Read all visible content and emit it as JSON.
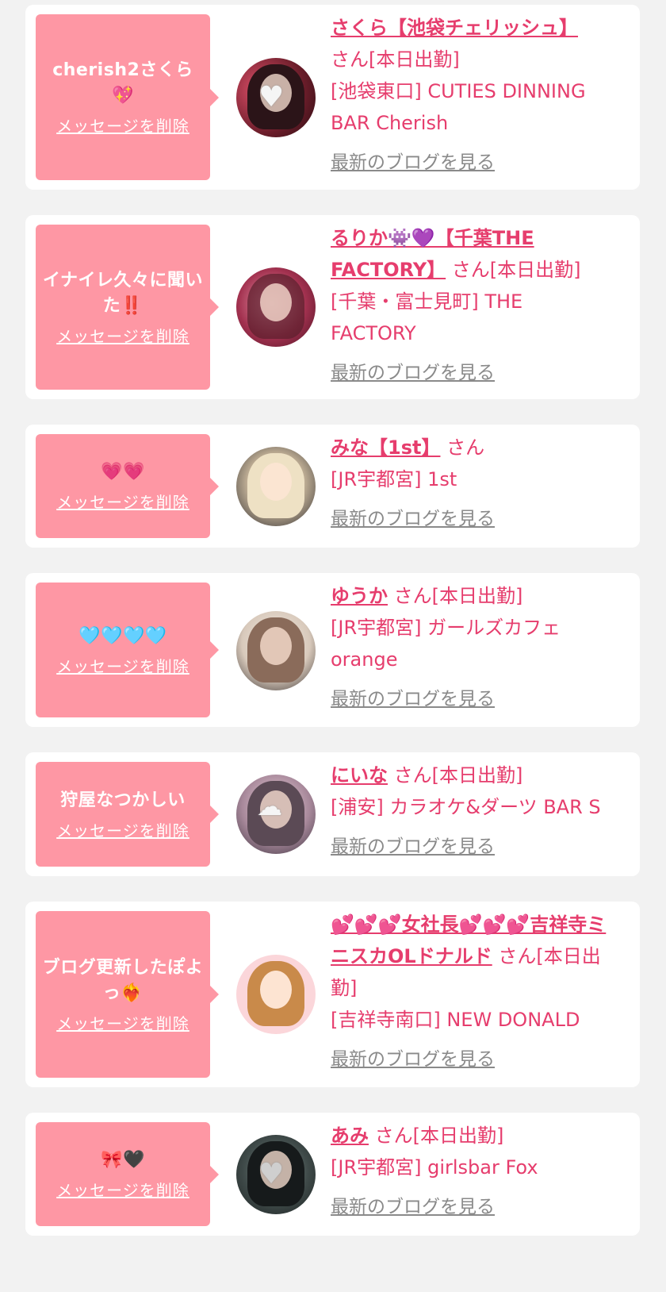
{
  "delete_label": "メッセージを削除",
  "blog_label": "最新のブログを見る",
  "colors": {
    "accent": "#e63d6d",
    "bubble": "#fe97a4",
    "link_gray": "#8a8a8a",
    "background": "#f2f2f2"
  },
  "items": [
    {
      "message": "cherish2さくら💖",
      "name": "さくら【池袋チェリッシュ】",
      "suffix": "さん[本日出勤]",
      "shop": "[池袋東口] CUTIES DINNING BAR Cherish",
      "avatar_icon": "heart-stamp-icon"
    },
    {
      "message": "イナイレ久々に聞いた‼️",
      "name": "るりか👾💜【千葉THE FACTORY】",
      "suffix": "さん[本日出勤]",
      "shop": "[千葉・富士見町] THE FACTORY",
      "avatar_icon": "portrait-icon"
    },
    {
      "message": "💗💗",
      "name": "みな【1st】",
      "suffix": "さん",
      "shop": "[JR宇都宮] 1st",
      "avatar_icon": "portrait-icon"
    },
    {
      "message": "🩵🩵🩵🩵",
      "name": "ゆうか",
      "suffix": "さん[本日出勤]",
      "shop": "[JR宇都宮] ガールズカフェorange",
      "avatar_icon": "portrait-icon"
    },
    {
      "message": "狩屋なつかしい",
      "name": "にいな",
      "suffix": "さん[本日出勤]",
      "shop": "[浦安] カラオケ&ダーツ BAR S",
      "avatar_icon": "cloud-stamp-icon"
    },
    {
      "message": "ブログ更新したぽよっ❤️‍🔥",
      "name": "💕💕💕女社長💕💕💕吉祥寺ミニスカOLドナルド",
      "suffix": "さん[本日出勤]",
      "shop": "[吉祥寺南口] NEW DONALD",
      "avatar_icon": "illustration-icon"
    },
    {
      "message": "🎀🖤",
      "name": "あみ",
      "suffix": "さん[本日出勤]",
      "shop": "[JR宇都宮] girlsbar Fox",
      "avatar_icon": "heart-stamp-icon"
    }
  ]
}
